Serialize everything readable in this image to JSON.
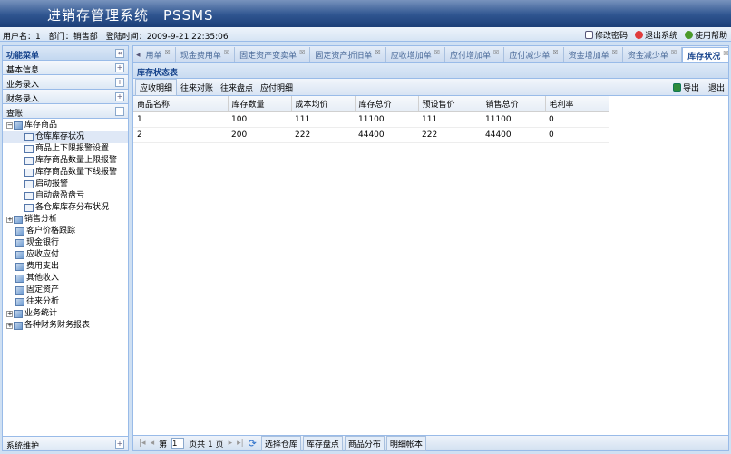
{
  "header": {
    "title": "进销存管理系统　PSSMS"
  },
  "info": {
    "user": "用户名：1　部门：销售部　登陆时间：2009-9-21 22:35:06",
    "change_password": "修改密码",
    "logout": "退出系统",
    "help": "使用帮助"
  },
  "sidebar": {
    "title": "功能菜单",
    "collapse": "«",
    "sections": [
      "基本信息",
      "业务录入",
      "财务录入",
      "查账"
    ],
    "bottom": "系统维护",
    "tree": [
      {
        "label": "库存商品",
        "level": 0,
        "expanded": true
      },
      {
        "label": "仓库库存状况",
        "level": 1,
        "selected": true
      },
      {
        "label": "商品上下限报警设置",
        "level": 1
      },
      {
        "label": "库存商品数量上限报警",
        "level": 1
      },
      {
        "label": "库存商品数量下线报警",
        "level": 1
      },
      {
        "label": "启动报警",
        "level": 1
      },
      {
        "label": "自动盘盈盘亏",
        "level": 1
      },
      {
        "label": "各仓库库存分布状况",
        "level": 1
      },
      {
        "label": "销售分析",
        "level": 0,
        "expanded": false
      },
      {
        "label": "客户价格跟踪",
        "level": 0
      },
      {
        "label": "现金银行",
        "level": 0
      },
      {
        "label": "应收应付",
        "level": 0
      },
      {
        "label": "费用支出",
        "level": 0
      },
      {
        "label": "其他收入",
        "level": 0
      },
      {
        "label": "固定资产",
        "level": 0
      },
      {
        "label": "往来分析",
        "level": 0
      },
      {
        "label": "业务统计",
        "level": 0,
        "expanded": false
      },
      {
        "label": "各种财务财务报表",
        "level": 0,
        "expanded": false
      }
    ]
  },
  "tabs": [
    "用单",
    "现金费用单",
    "固定资产变卖单",
    "固定资产折旧单",
    "应收增加单",
    "应付增加单",
    "应付减少单",
    "资金增加单",
    "资金减少单",
    "库存状况"
  ],
  "active_tab": "库存状况",
  "panel": {
    "title": "库存状态表",
    "toolbar": [
      "应收明细",
      "往来对账",
      "往来盘点",
      "应付明细"
    ],
    "export": "导出",
    "exit": "退出"
  },
  "table": {
    "columns": [
      "商品名称",
      "库存数量",
      "成本均价",
      "库存总价",
      "预设售价",
      "销售总价",
      "毛利率"
    ],
    "rows": [
      [
        "1",
        "100",
        "111",
        "11100",
        "111",
        "11100",
        "0"
      ],
      [
        "2",
        "200",
        "222",
        "44400",
        "222",
        "44400",
        "0"
      ]
    ]
  },
  "pager": {
    "page_prefix": "第",
    "page": "1",
    "page_suffix": "页共 1 页",
    "buttons": [
      "选择仓库",
      "库存盘点",
      "商品分布",
      "明细帐本"
    ]
  }
}
